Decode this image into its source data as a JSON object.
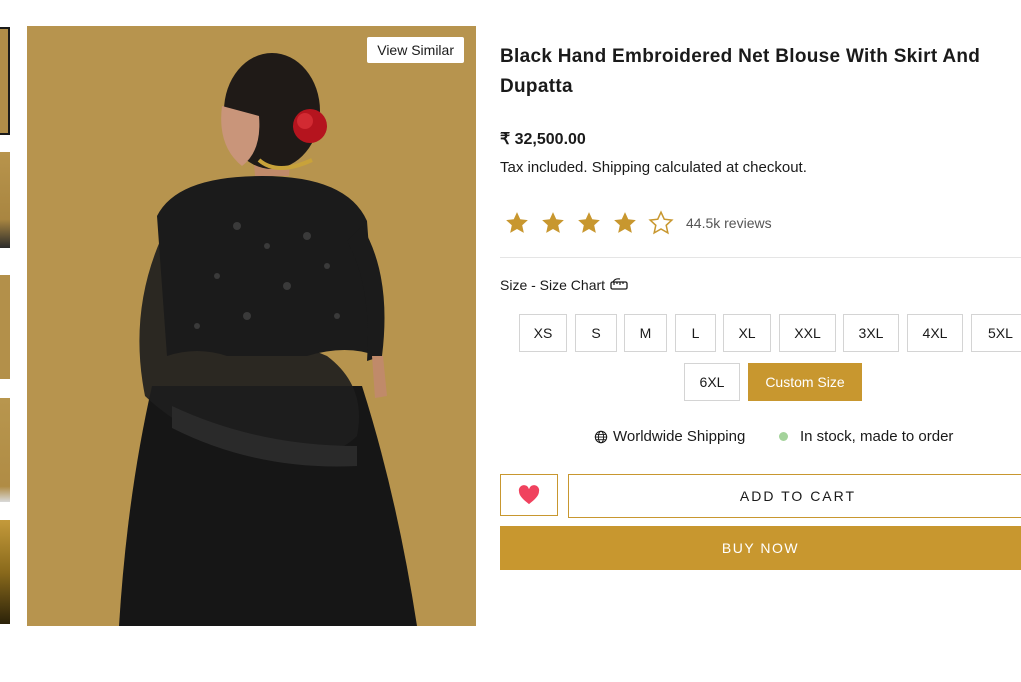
{
  "gallery": {
    "view_similar_label": "View Similar",
    "image_alt": "Black Hand Embroidered Net Blouse With Skirt And Dupatta"
  },
  "product": {
    "title": "Black Hand Embroidered Net Blouse With Skirt And Dupatta",
    "price": "₹ 32,500.00",
    "tax_prefix": "Tax included.",
    "tax_link": "Shipping",
    "tax_suffix": "calculated at checkout.",
    "rating": {
      "stars_filled": 4,
      "stars_total": 5,
      "reviews_label": "44.5k reviews"
    },
    "size_label": "Size - Size Chart",
    "sizes": [
      "XS",
      "S",
      "M",
      "L",
      "XL",
      "XXL",
      "3XL",
      "4XL",
      "5XL",
      "6XL",
      "Custom Size"
    ],
    "selected_size": "Custom Size",
    "shipping_label": "Worldwide Shipping",
    "stock_label": "In stock, made to order",
    "add_to_cart_label": "ADD TO CART",
    "buy_now_label": "BUY NOW"
  },
  "icons": {
    "star": "star-icon",
    "size_chart": "ruler-icon",
    "globe": "globe-icon",
    "heart": "heart-icon"
  },
  "colors": {
    "accent": "#c8972f",
    "star": "#c8972f",
    "heart": "#f0425e",
    "stock_dot": "#a4d39b",
    "image_background": "#b7944e"
  }
}
